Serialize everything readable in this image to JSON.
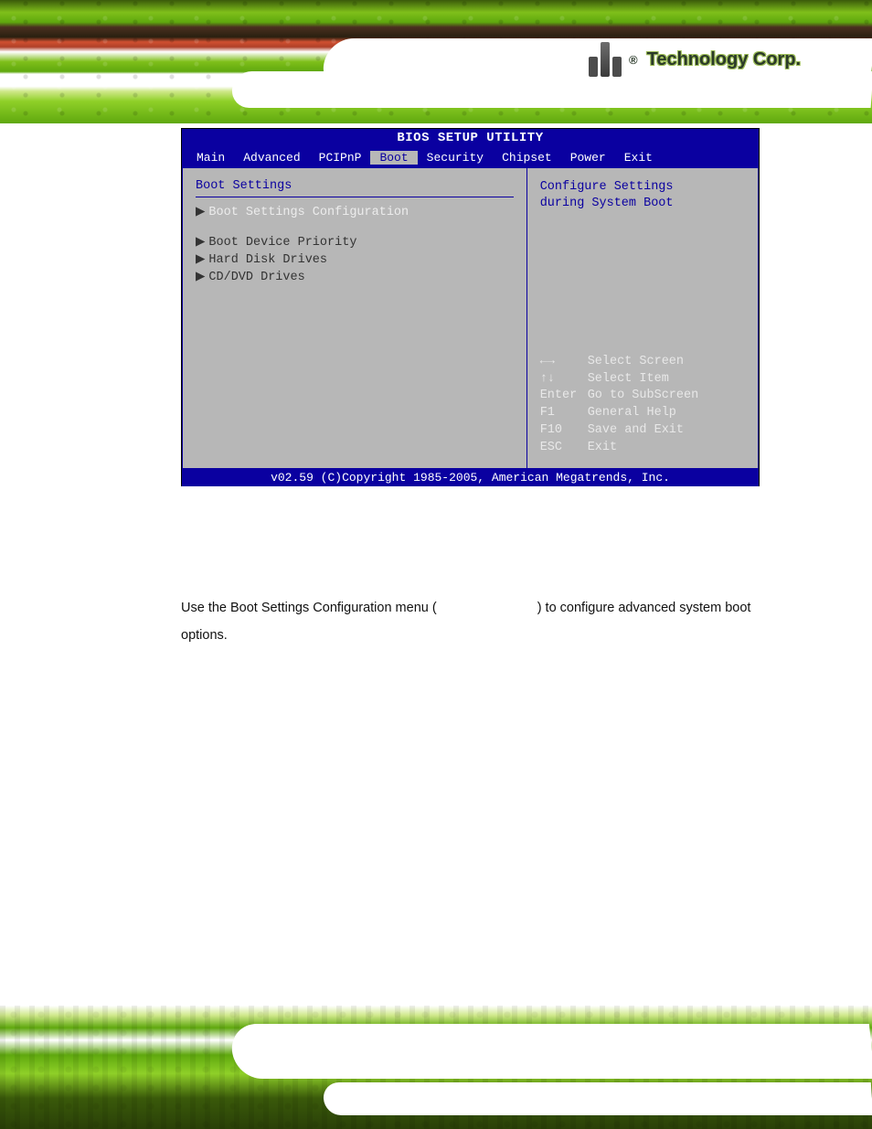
{
  "brand": {
    "registered_mark": "®",
    "company_text": "Technology Corp."
  },
  "bios": {
    "title": "BIOS SETUP UTILITY",
    "tabs": [
      "Main",
      "Advanced",
      "PCIPnP",
      "Boot",
      "Security",
      "Chipset",
      "Power",
      "Exit"
    ],
    "active_tab_index": 3,
    "left_heading": "Boot Settings",
    "items": [
      "Boot Settings Configuration",
      "Boot Device Priority",
      "Hard Disk Drives",
      "CD/DVD Drives"
    ],
    "help_top_line1": "Configure Settings",
    "help_top_line2": "during System Boot",
    "keys": [
      {
        "key": "←→",
        "label": "Select Screen"
      },
      {
        "key": "↑↓",
        "label": "Select Item"
      },
      {
        "key": "Enter",
        "label": "Go to SubScreen"
      },
      {
        "key": "F1",
        "label": "General Help"
      },
      {
        "key": "F10",
        "label": "Save and Exit"
      },
      {
        "key": "ESC",
        "label": "Exit"
      }
    ],
    "footer": "v02.59 (C)Copyright 1985-2005, American Megatrends, Inc."
  },
  "doc": {
    "para_part1": "Use the Boot Settings Configuration menu (",
    "para_part2": ") to configure advanced system boot options."
  }
}
